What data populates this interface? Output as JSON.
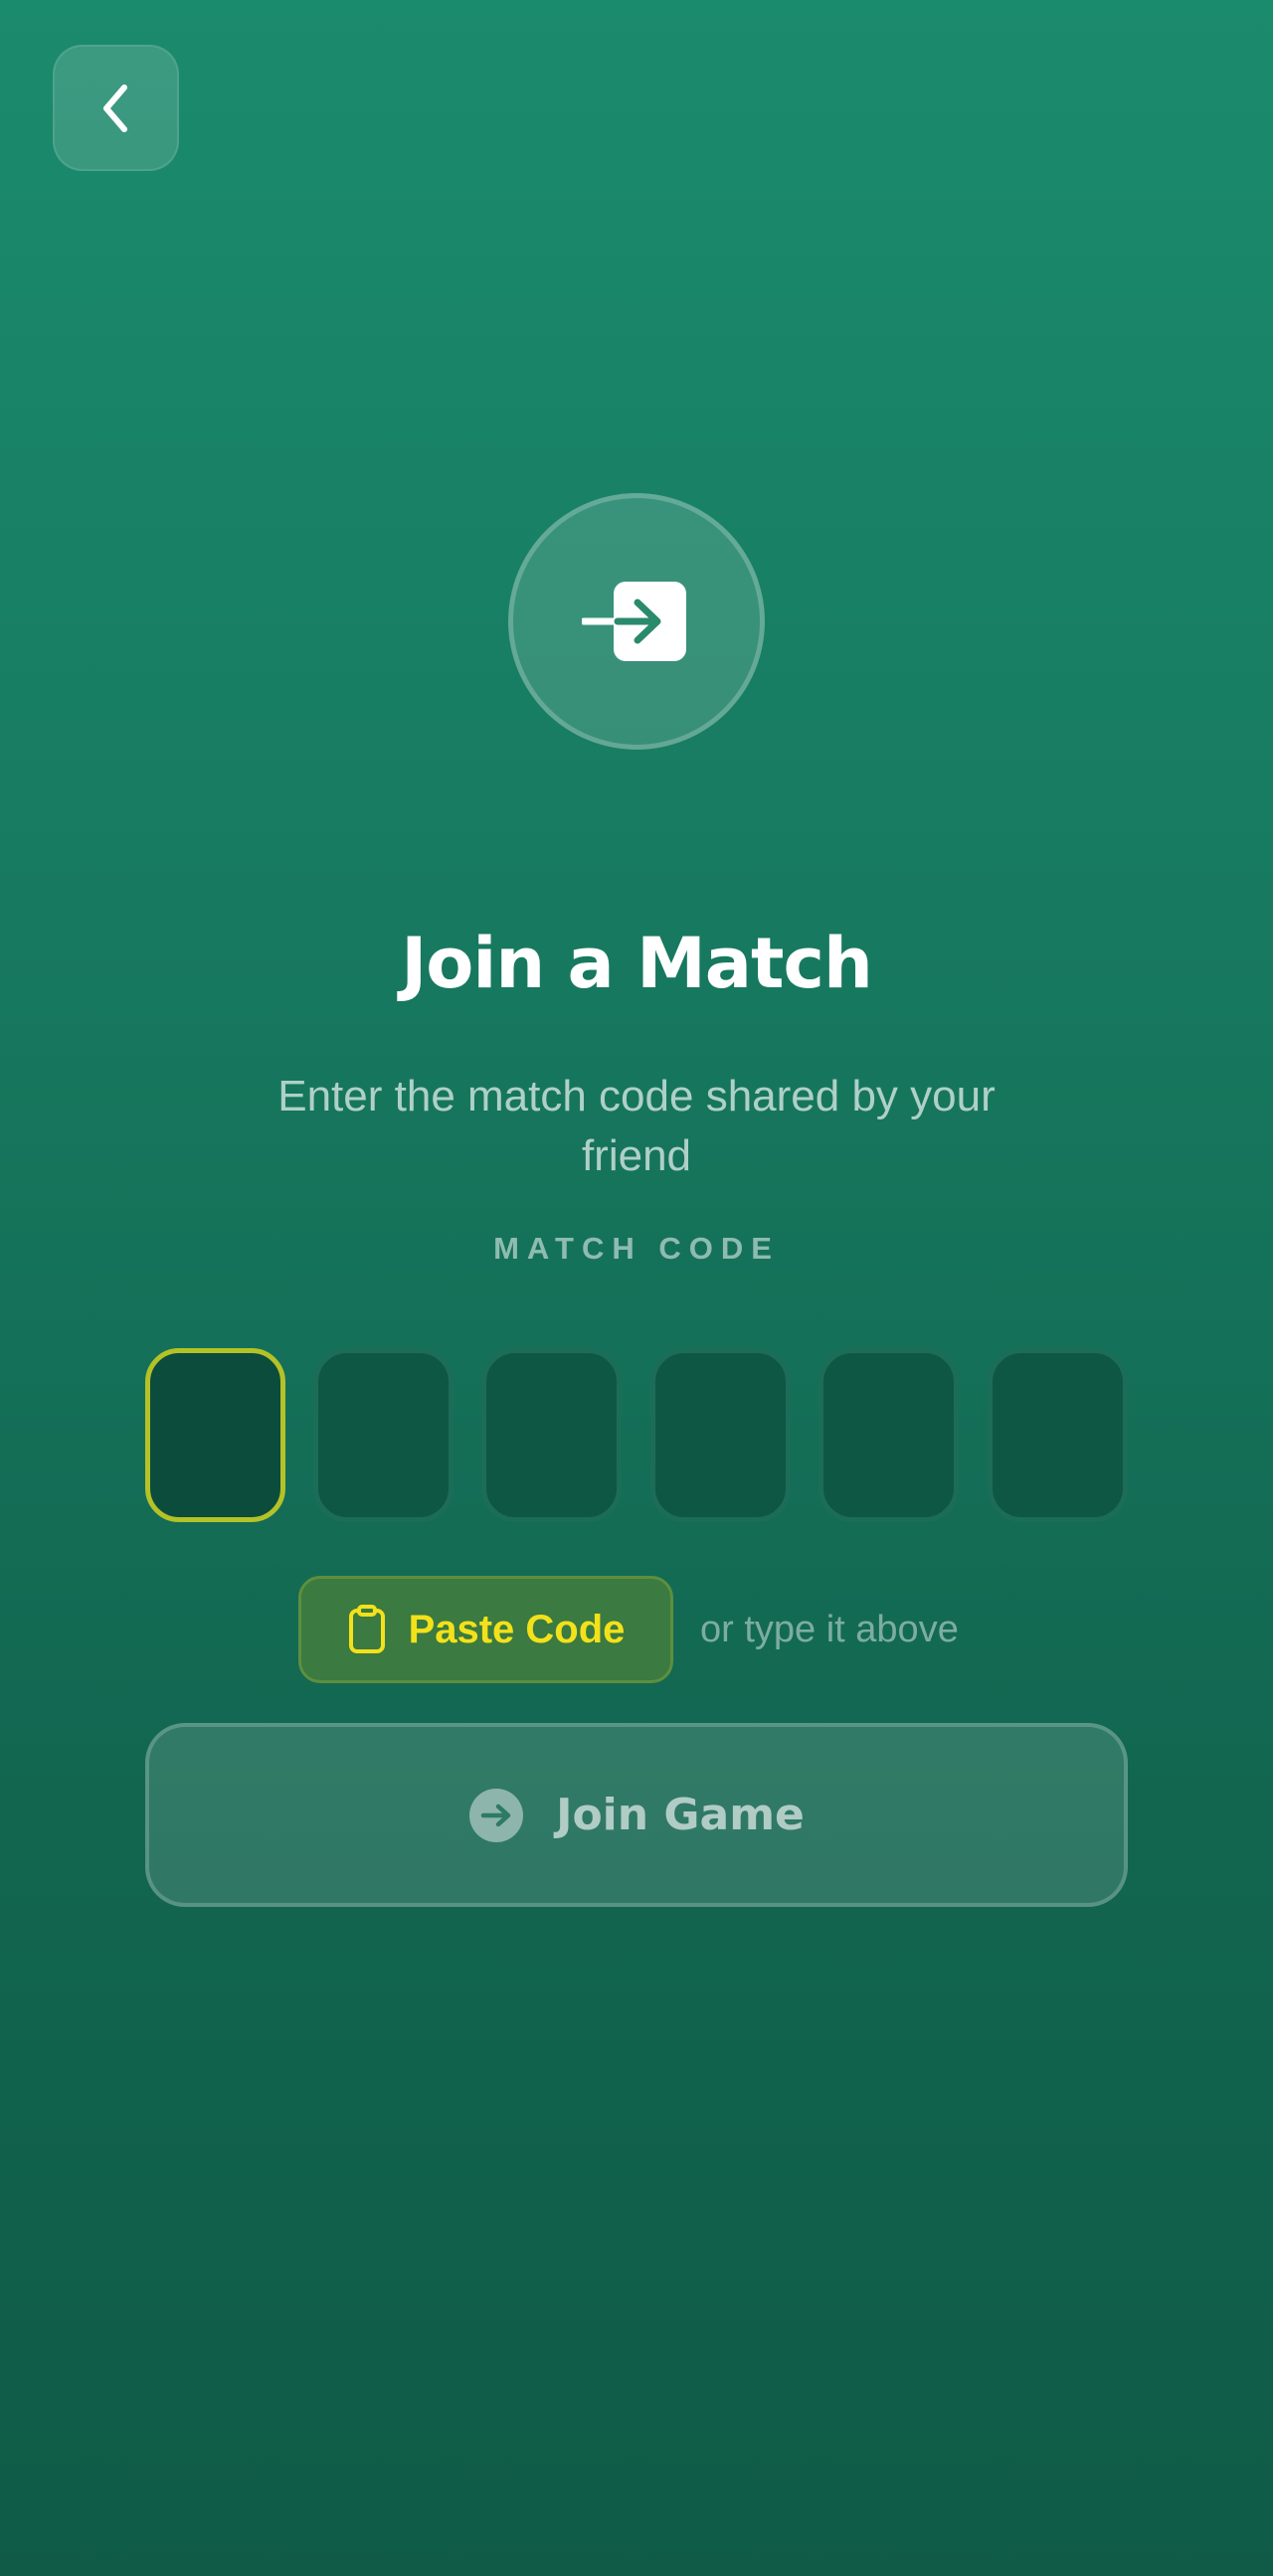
{
  "header": {
    "back_icon": "chevron-left-icon"
  },
  "hero": {
    "icon": "enter-arrow-icon",
    "title": "Join a Match",
    "subtitle": "Enter the match code shared by your friend"
  },
  "code": {
    "label": "MATCH CODE",
    "digits": [
      "",
      "",
      "",
      "",
      "",
      ""
    ],
    "active_index": 0
  },
  "paste": {
    "label": "Paste Code",
    "icon": "clipboard-icon",
    "hint": "or type it above"
  },
  "join": {
    "label": "Join Game",
    "icon": "arrow-right-circle-icon"
  },
  "colors": {
    "accent": "#f3e11a",
    "active_border": "#b4c227",
    "background_top": "#1b8b6d",
    "background_bottom": "#0f5b47"
  }
}
